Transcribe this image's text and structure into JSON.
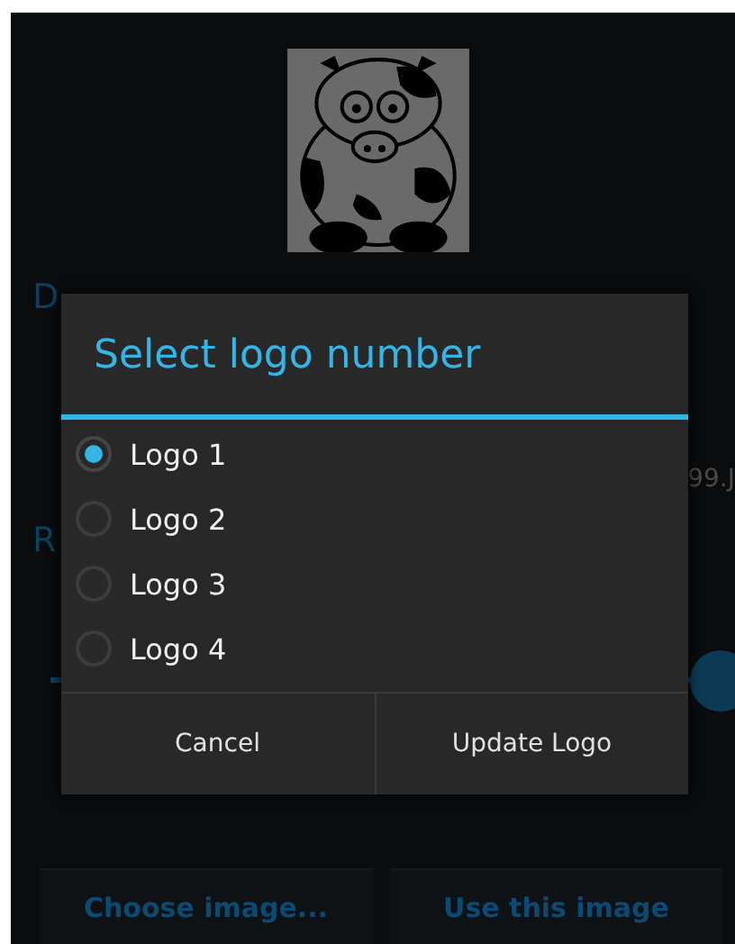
{
  "background": {
    "section_1_title": "D",
    "cut_value": "99.J",
    "section_2_title": "R",
    "slider": {
      "level": 1.0
    },
    "buttons": [
      "Choose image...",
      "Use this image"
    ]
  },
  "dialog": {
    "title": "Select logo number",
    "options": [
      {
        "label": "Logo 1",
        "selected": true
      },
      {
        "label": "Logo 2",
        "selected": false
      },
      {
        "label": "Logo 3",
        "selected": false
      },
      {
        "label": "Logo 4",
        "selected": false
      }
    ],
    "buttons": [
      "Cancel",
      "Update Logo"
    ]
  }
}
